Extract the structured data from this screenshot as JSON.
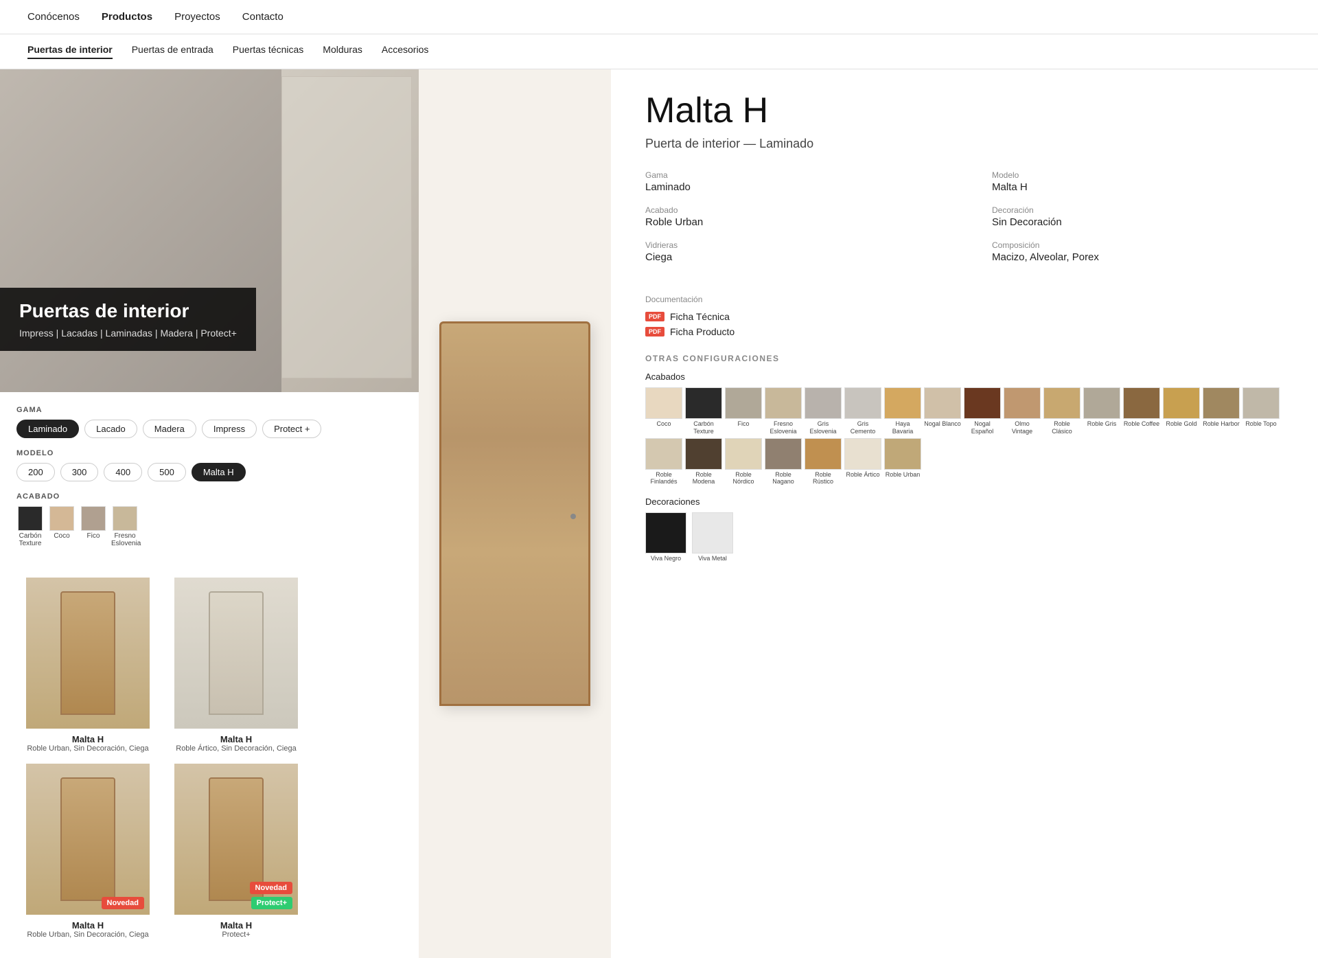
{
  "nav": {
    "items": [
      {
        "label": "Conócenos",
        "active": false
      },
      {
        "label": "Productos",
        "active": true
      },
      {
        "label": "Proyectos",
        "active": false
      },
      {
        "label": "Contacto",
        "active": false
      }
    ]
  },
  "subnav": {
    "items": [
      {
        "label": "Puertas de interior",
        "active": true
      },
      {
        "label": "Puertas de entrada",
        "active": false
      },
      {
        "label": "Puertas técnicas",
        "active": false
      },
      {
        "label": "Molduras",
        "active": false
      },
      {
        "label": "Accesorios",
        "active": false
      }
    ]
  },
  "hero": {
    "title": "Puertas de interior",
    "subtitle": "Impress | Lacadas | Laminadas | Madera | Protect+"
  },
  "filters": {
    "gama_label": "GAMA",
    "gama_buttons": [
      {
        "label": "Laminado",
        "active": true
      },
      {
        "label": "Lacado",
        "active": false
      },
      {
        "label": "Madera",
        "active": false
      },
      {
        "label": "Impress",
        "active": false
      },
      {
        "label": "Protect +",
        "active": false
      }
    ],
    "modelo_label": "MODELO",
    "modelo_buttons": [
      {
        "label": "200",
        "active": false
      },
      {
        "label": "300",
        "active": false
      },
      {
        "label": "400",
        "active": false
      },
      {
        "label": "500",
        "active": false
      },
      {
        "label": "Malta H",
        "active": true
      }
    ],
    "acabado_label": "ACABADO",
    "acabado_swatches": [
      {
        "name": "Carbón Texture",
        "color": "#2a2a2a"
      },
      {
        "name": "Coco",
        "color": "#d4b896"
      },
      {
        "name": "Fico",
        "color": "#b0a090"
      },
      {
        "name": "Fresno Eslovenia",
        "color": "#c8b89a"
      }
    ]
  },
  "product_cards": [
    {
      "name": "Malta H",
      "desc": "Roble Urban, Sin Decoración, Ciega",
      "badge": null
    },
    {
      "name": "Malta H",
      "desc": "Roble Ártico, Sin Decoración, Ciega",
      "badge": null
    },
    {
      "name": "Malta H",
      "desc": "Roble Urban, Sin Decoración, Ciega",
      "badge": "Novedad"
    },
    {
      "name": "Malta H",
      "desc": "Protect+",
      "badge": "Novedad Protect+"
    }
  ],
  "product_detail": {
    "title": "Malta H",
    "subtitle": "Puerta de interior — Laminado",
    "info": {
      "gama_label": "Gama",
      "gama_val": "Laminado",
      "modelo_label": "Modelo",
      "modelo_val": "Malta H",
      "acabado_label": "Acabado",
      "acabado_val": "Roble Urban",
      "decoracion_label": "Decoración",
      "decoracion_val": "Sin Decoración",
      "vidrieras_label": "Vidrieras",
      "vidrieras_val": "Ciega",
      "composicion_label": "Composición",
      "composicion_val": "Macizo, Alveolar, Porex"
    },
    "documentacion_label": "Documentación",
    "docs": [
      {
        "label": "Ficha Técnica"
      },
      {
        "label": "Ficha Producto"
      }
    ],
    "otras_label": "OTRAS CONFIGURACIONES",
    "acabados_label": "Acabados",
    "acabados_swatches": [
      {
        "name": "Coco",
        "color": "#e8d8c0"
      },
      {
        "name": "Carbón Texture",
        "color": "#2a2a2a"
      },
      {
        "name": "Fico",
        "color": "#b0a898"
      },
      {
        "name": "Fresno Eslovenia",
        "color": "#c8b89a"
      },
      {
        "name": "Gris Eslovenia",
        "color": "#b8b2ac"
      },
      {
        "name": "Gris Cemento",
        "color": "#c8c4be"
      },
      {
        "name": "Haya Bavaria",
        "color": "#d4a860"
      },
      {
        "name": "Nogal Blanco",
        "color": "#d0c0a8"
      },
      {
        "name": "Nogal Español",
        "color": "#6a3820"
      },
      {
        "name": "Olmo Vintage",
        "color": "#c09870"
      },
      {
        "name": "Roble Clásico",
        "color": "#c8a870"
      },
      {
        "name": "Roble Gris",
        "color": "#b0a898"
      },
      {
        "name": "Roble Coffee",
        "color": "#8a6840"
      },
      {
        "name": "Roble Gold",
        "color": "#c8a050"
      },
      {
        "name": "Roble Harbor",
        "color": "#a08860"
      },
      {
        "name": "Roble Topo",
        "color": "#c0b8a8"
      },
      {
        "name": "Roble Finlandés",
        "color": "#d4c8b0"
      },
      {
        "name": "Roble Modena",
        "color": "#504030"
      },
      {
        "name": "Roble Nórdico",
        "color": "#e0d4b8"
      },
      {
        "name": "Roble Nagano",
        "color": "#908070"
      },
      {
        "name": "Roble Rústico",
        "color": "#c09050"
      },
      {
        "name": "Roble Ártico",
        "color": "#e8e0d0"
      },
      {
        "name": "Roble Urban",
        "color": "#c0a878"
      }
    ],
    "decoraciones_label": "Decoraciones",
    "decoraciones_swatches": [
      {
        "name": "Viva Negro",
        "color": "#1a1a1a"
      },
      {
        "name": "Viva Metal",
        "color": "#e8e8e8"
      }
    ]
  }
}
